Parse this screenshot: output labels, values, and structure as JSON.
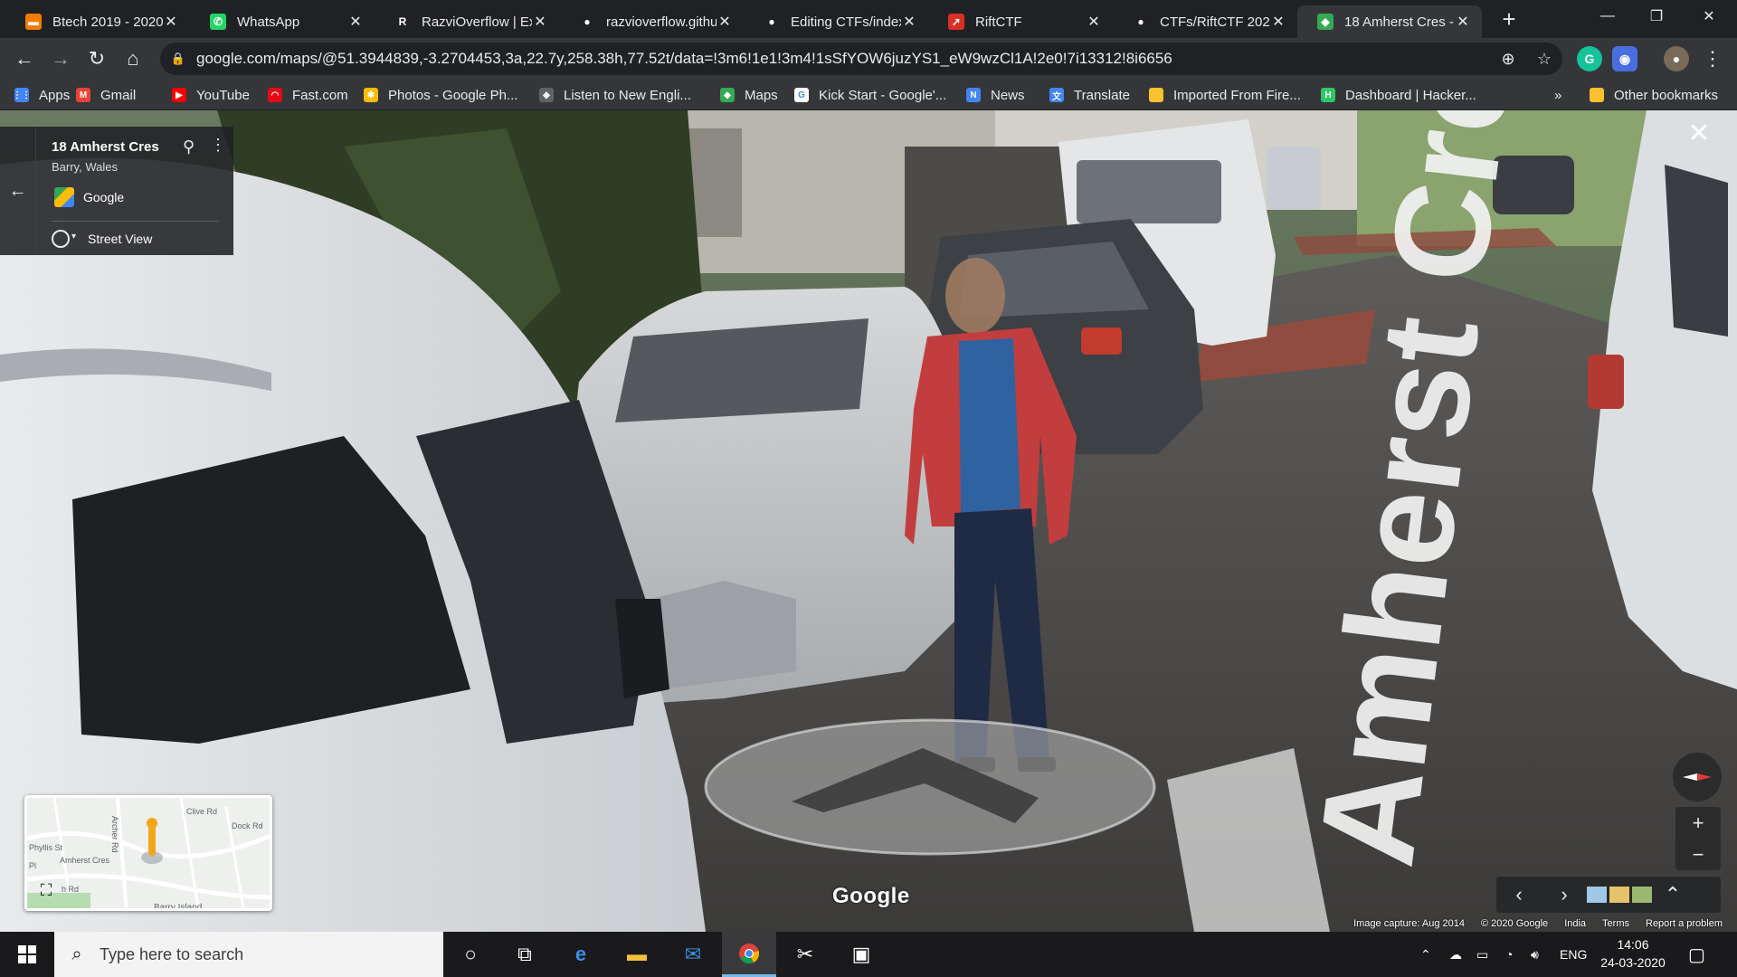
{
  "browser": {
    "tabs": [
      {
        "title": "Btech 2019 - 2020",
        "favicon_color": "#f57c00",
        "favicon_glyph": "▬",
        "active": false
      },
      {
        "title": "WhatsApp",
        "favicon_color": "#25d366",
        "favicon_glyph": "✆",
        "active": false
      },
      {
        "title": "RazviOverflow | Ex",
        "favicon_color": "#202124",
        "favicon_glyph": "R",
        "active": false
      },
      {
        "title": "razvioverflow.githu",
        "favicon_color": "#202124",
        "favicon_glyph": "●",
        "active": false
      },
      {
        "title": "Editing CTFs/index",
        "favicon_color": "#202124",
        "favicon_glyph": "●",
        "active": false
      },
      {
        "title": "RiftCTF",
        "favicon_color": "#d93025",
        "favicon_glyph": "➚",
        "active": false
      },
      {
        "title": "CTFs/RiftCTF 2020",
        "favicon_color": "#202124",
        "favicon_glyph": "●",
        "active": false
      },
      {
        "title": "18 Amherst Cres -",
        "favicon_color": "#34a853",
        "favicon_glyph": "◆",
        "active": true
      }
    ],
    "new_tab_glyph": "+",
    "window_controls": {
      "minimize": "—",
      "restore": "❐",
      "close": "✕"
    },
    "address_bar": {
      "url": "google.com/maps/@51.3944839,-3.2704453,3a,22.7y,258.38h,77.52t/data=!3m6!1e1!3m4!1sSfYOW6juzYS1_eW9wzCl1A!2e0!7i13312!8i6656"
    },
    "nav": {
      "back": "←",
      "forward": "→",
      "reload": "↻",
      "home": "⌂"
    },
    "bookmarks": [
      {
        "label": "Apps",
        "color": "#4285f4",
        "glyph": "⋮⋮"
      },
      {
        "label": "Gmail",
        "color": "#ea4335",
        "glyph": "M"
      },
      {
        "label": "YouTube",
        "color": "#ff0000",
        "glyph": "▶"
      },
      {
        "label": "Fast.com",
        "color": "#e50914",
        "glyph": "◠"
      },
      {
        "label": "Photos - Google Ph...",
        "color": "#fbbc04",
        "glyph": "✱"
      },
      {
        "label": "Listen to New Engli...",
        "color": "#5f6368",
        "glyph": "◈"
      },
      {
        "label": "Maps",
        "color": "#34a853",
        "glyph": "◆"
      },
      {
        "label": "Kick Start - Google'...",
        "color": "#ffffff",
        "glyph": "G"
      },
      {
        "label": "News",
        "color": "#4285f4",
        "glyph": "N"
      },
      {
        "label": "Translate",
        "color": "#4285f4",
        "glyph": "文"
      },
      {
        "label": "Imported From Fire...",
        "color": "#fbc02d",
        "glyph": ""
      },
      {
        "label": "Dashboard | Hacker...",
        "color": "#2ec866",
        "glyph": "H"
      }
    ],
    "bookmarks_overflow": "»",
    "other_bookmarks": "Other bookmarks"
  },
  "streetview": {
    "place_title": "18 Amherst Cres",
    "place_subtitle": "Barry, Wales",
    "source": "Google",
    "mode_label": "Street View",
    "road_label": "Amherst Cres",
    "wordmark": "Google",
    "minimap_labels": [
      "Clive Rd",
      "Archer Rd",
      "Dock Rd",
      "Amherst Cres",
      "Phyllis St",
      "Pl",
      "h Rd",
      "Barry Island"
    ],
    "footer": [
      "Image capture: Aug 2014",
      "© 2020 Google",
      "India",
      "Terms",
      "Report a problem"
    ],
    "zoom_in": "+",
    "zoom_out": "−"
  },
  "taskbar": {
    "search_placeholder": "Type here to search",
    "language": "ENG",
    "time": "14:06",
    "date": "24-03-2020"
  }
}
